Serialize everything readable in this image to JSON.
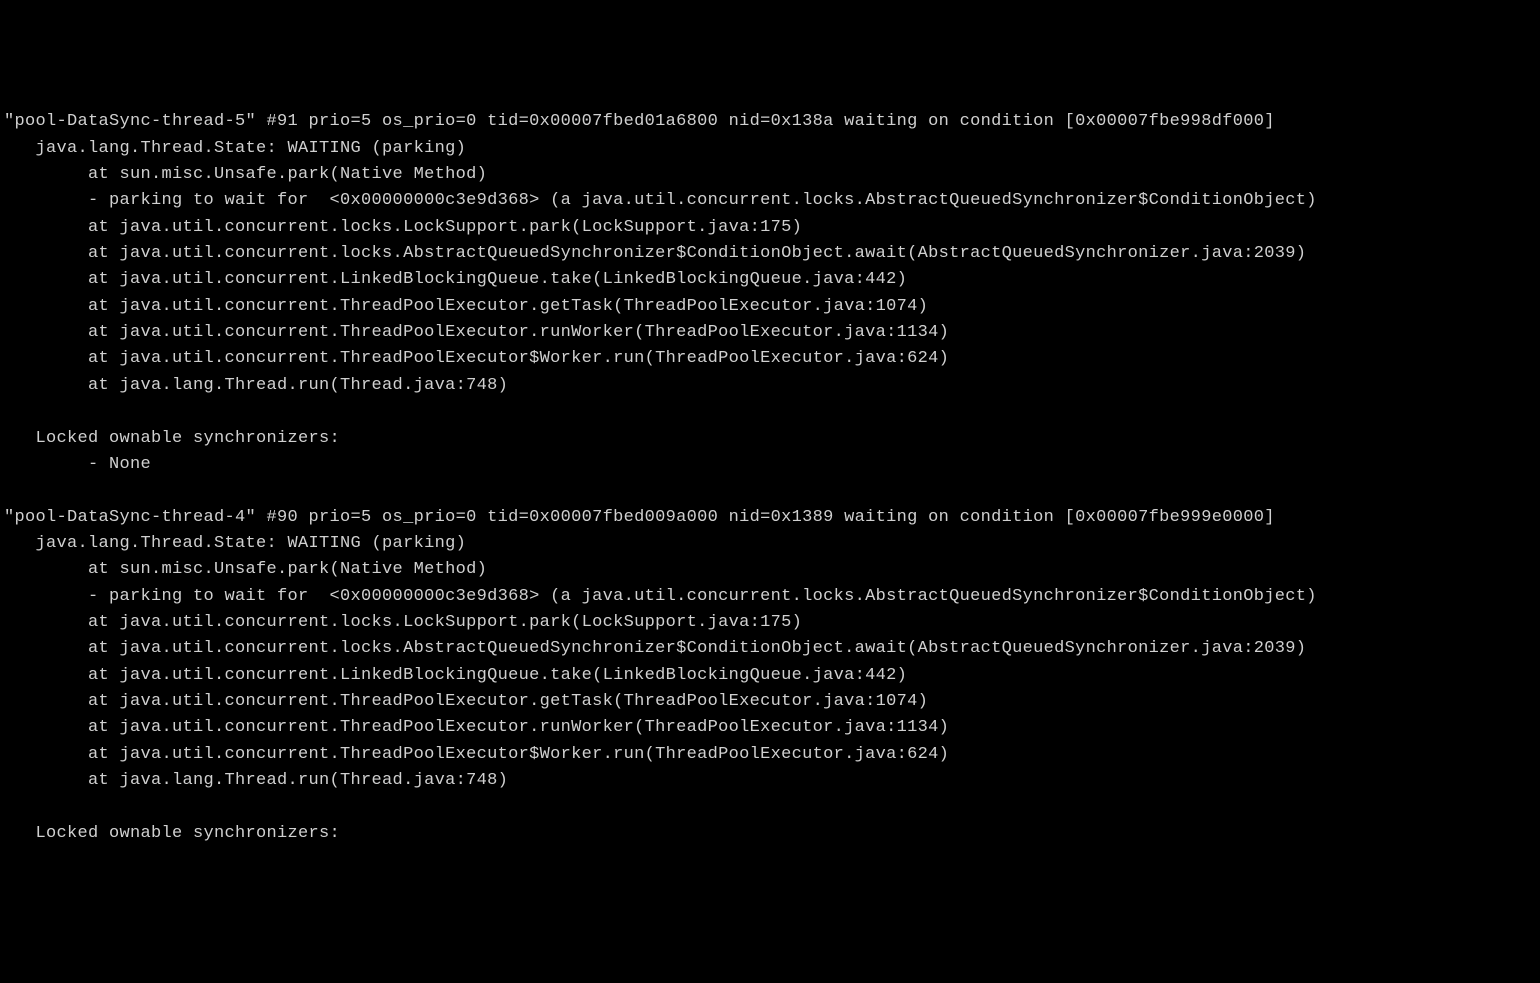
{
  "threads": [
    {
      "header": "\"pool-DataSync-thread-5\" #91 prio=5 os_prio=0 tid=0x00007fbed01a6800 nid=0x138a waiting on condition [0x00007fbe998df000]",
      "state": "   java.lang.Thread.State: WAITING (parking)",
      "stack": [
        "        at sun.misc.Unsafe.park(Native Method)",
        "        - parking to wait for  <0x00000000c3e9d368> (a java.util.concurrent.locks.AbstractQueuedSynchronizer$ConditionObject)",
        "        at java.util.concurrent.locks.LockSupport.park(LockSupport.java:175)",
        "        at java.util.concurrent.locks.AbstractQueuedSynchronizer$ConditionObject.await(AbstractQueuedSynchronizer.java:2039)",
        "        at java.util.concurrent.LinkedBlockingQueue.take(LinkedBlockingQueue.java:442)",
        "        at java.util.concurrent.ThreadPoolExecutor.getTask(ThreadPoolExecutor.java:1074)",
        "        at java.util.concurrent.ThreadPoolExecutor.runWorker(ThreadPoolExecutor.java:1134)",
        "        at java.util.concurrent.ThreadPoolExecutor$Worker.run(ThreadPoolExecutor.java:624)",
        "        at java.lang.Thread.run(Thread.java:748)"
      ],
      "locked_header": "   Locked ownable synchronizers:",
      "locked_items": [
        "        - None"
      ]
    },
    {
      "header": "\"pool-DataSync-thread-4\" #90 prio=5 os_prio=0 tid=0x00007fbed009a000 nid=0x1389 waiting on condition [0x00007fbe999e0000]",
      "state": "   java.lang.Thread.State: WAITING (parking)",
      "stack": [
        "        at sun.misc.Unsafe.park(Native Method)",
        "        - parking to wait for  <0x00000000c3e9d368> (a java.util.concurrent.locks.AbstractQueuedSynchronizer$ConditionObject)",
        "        at java.util.concurrent.locks.LockSupport.park(LockSupport.java:175)",
        "        at java.util.concurrent.locks.AbstractQueuedSynchronizer$ConditionObject.await(AbstractQueuedSynchronizer.java:2039)",
        "        at java.util.concurrent.LinkedBlockingQueue.take(LinkedBlockingQueue.java:442)",
        "        at java.util.concurrent.ThreadPoolExecutor.getTask(ThreadPoolExecutor.java:1074)",
        "        at java.util.concurrent.ThreadPoolExecutor.runWorker(ThreadPoolExecutor.java:1134)",
        "        at java.util.concurrent.ThreadPoolExecutor$Worker.run(ThreadPoolExecutor.java:624)",
        "        at java.lang.Thread.run(Thread.java:748)"
      ],
      "locked_header": "   Locked ownable synchronizers:",
      "locked_items": []
    }
  ]
}
